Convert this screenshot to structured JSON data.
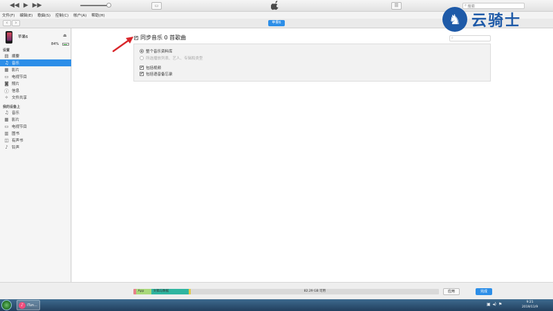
{
  "player": {
    "airplay_icon": "airplay-icon",
    "list_icon": "list-view-icon",
    "search_placeholder": "搜索"
  },
  "menu": [
    "文件(F)",
    "编辑(E)",
    "歌曲(S)",
    "控制(C)",
    "帐户(A)",
    "帮助(H)"
  ],
  "nav": {
    "back": "‹",
    "forward": "›",
    "device_pill": "苹果6"
  },
  "sidebar": {
    "device_name": "苹果6",
    "battery_percent": "84%",
    "battery_level": 0.84,
    "settings_title": "设置",
    "settings_items": [
      {
        "label": "摘要",
        "icon": "summary-icon"
      },
      {
        "label": "音乐",
        "icon": "music-icon"
      },
      {
        "label": "影片",
        "icon": "movie-icon"
      },
      {
        "label": "电视节目",
        "icon": "tv-icon"
      },
      {
        "label": "照片",
        "icon": "camera-icon"
      },
      {
        "label": "信息",
        "icon": "info-icon"
      },
      {
        "label": "文件共享",
        "icon": "apps-icon"
      }
    ],
    "ondevice_title": "我的设备上",
    "ondevice_items": [
      {
        "label": "音乐",
        "icon": "music-icon"
      },
      {
        "label": "影片",
        "icon": "movie-icon"
      },
      {
        "label": "电视节目",
        "icon": "tv-icon"
      },
      {
        "label": "图书",
        "icon": "book-icon"
      },
      {
        "label": "有声书",
        "icon": "audiobook-icon"
      },
      {
        "label": "铃声",
        "icon": "bell-icon"
      }
    ]
  },
  "main": {
    "sync_label": "同步音乐 0 首歌曲",
    "sync_checked": true,
    "options": {
      "entire_library": "整个音乐资料库",
      "selected": "所选播放列表、艺人、专辑和类型",
      "include_videos": "包括视频",
      "include_voice_memos": "包括语音备忘录"
    }
  },
  "capacity": {
    "segments": [
      {
        "label": "",
        "color": "#e6818a",
        "share": 0.008
      },
      {
        "label": "App",
        "color": "#a9d87a",
        "share": 0.05
      },
      {
        "label": "文稿与数据",
        "color": "#2fb5a0",
        "share": 0.123
      },
      {
        "label": "",
        "color": "#e5c94a",
        "share": 0.006
      },
      {
        "label": "82.29 GB 可用",
        "color": "#d9d9d9",
        "share": 0.813
      }
    ],
    "apply": "应用",
    "done": "完成"
  },
  "watermark": {
    "text": "云骑士"
  },
  "taskbar": {
    "app_label": "iTun...",
    "time": "9:21",
    "date": "2019/11/9"
  },
  "colors": {
    "accent": "#2c8ee8",
    "annotation": "#d9262a"
  }
}
